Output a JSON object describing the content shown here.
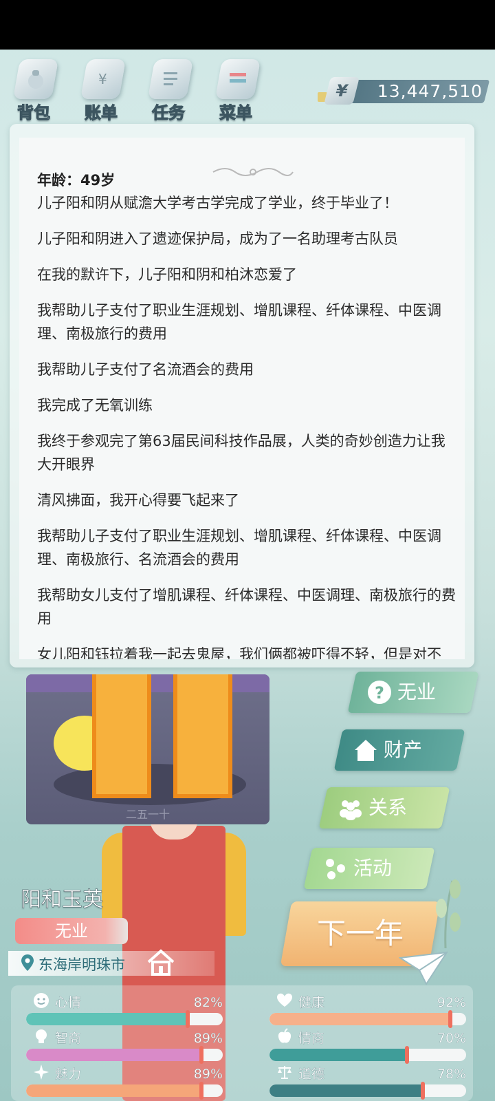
{
  "toolbar": {
    "items": [
      {
        "label": "背包",
        "icon": "backpack-icon"
      },
      {
        "label": "账单",
        "icon": "bill-icon"
      },
      {
        "label": "任务",
        "icon": "task-icon"
      },
      {
        "label": "菜单",
        "icon": "menu-icon"
      }
    ],
    "currency_symbol": "¥",
    "money": "13,447,510"
  },
  "log": {
    "age": "年龄：49岁",
    "entries": [
      "儿子阳和阴从赋澹大学考古学完成了学业，终于毕业了！",
      "儿子阳和阴进入了遗迹保护局，成为了一名助理考古队员",
      "在我的默许下，儿子阳和阴和柏沐恋爱了",
      "我帮助儿子支付了职业生涯规划、增肌课程、纤体课程、中医调理、南极旅行的费用",
      "我帮助儿子支付了名流酒会的费用",
      "我完成了无氧训练",
      "我终于参观完了第63届民间科技作品展，人类的奇妙创造力让我大开眼界",
      "清风拂面，我开心得要飞起来了",
      "我帮助儿子支付了职业生涯规划、增肌课程、纤体课程、中医调理、南极旅行、名流酒会的费用",
      "我帮助女儿支付了增肌课程、纤体课程、中医调理、南极旅行的费用",
      "女儿阳和钰拉着我一起去鬼屋，我们俩都被吓得不轻，但是对不起，下次还敢去"
    ]
  },
  "photo": {
    "caption": "二五一十"
  },
  "profile": {
    "name": "阳和玉英",
    "job": "无业",
    "location": "东海岸明珠市"
  },
  "actions": {
    "job": "无业",
    "assets": "财产",
    "relations": "关系",
    "activities": "活动",
    "next_year": "下一年"
  },
  "stats": [
    {
      "name": "心情",
      "value": "82%",
      "level": 0.82,
      "color": "#5fc3b7",
      "icon": "smile-icon"
    },
    {
      "name": "健康",
      "value": "92%",
      "level": 0.92,
      "color": "#f6b08a",
      "icon": "heart-icon"
    },
    {
      "name": "智商",
      "value": "89%",
      "level": 0.89,
      "color": "#d98ac8",
      "icon": "bulb-icon"
    },
    {
      "name": "情商",
      "value": "70%",
      "level": 0.7,
      "color": "#3f9d99",
      "icon": "apple-icon"
    },
    {
      "name": "魅力",
      "value": "89%",
      "level": 0.89,
      "color": "#f5a679",
      "icon": "sparkle-icon"
    },
    {
      "name": "道德",
      "value": "78%",
      "level": 0.78,
      "color": "#3d7f84",
      "icon": "scales-icon"
    }
  ]
}
